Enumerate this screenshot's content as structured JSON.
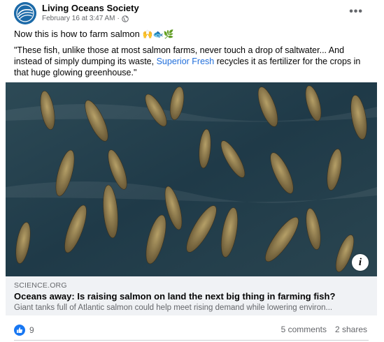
{
  "post": {
    "page_name": "Living Oceans Society",
    "timestamp": "February 16 at 3:47 AM",
    "separator": "·",
    "line1": "Now this is how to farm salmon",
    "emoji": "🙌🐟🌿",
    "quote_before": "\"These fish, unlike those at most salmon farms, never touch a drop of saltwater... And instead of simply dumping its waste, ",
    "quote_link": "Superior Fresh",
    "quote_after": " recycles it as fertilizer for the crops in that huge glowing greenhouse.\""
  },
  "link_preview": {
    "domain": "SCIENCE.ORG",
    "headline": "Oceans away: Is raising salmon on land the next big thing in farming fish?",
    "description": "Giant tanks full of Atlantic salmon could help meet rising demand while lowering environ..."
  },
  "footer": {
    "reaction_count": "9",
    "comments": "5 comments",
    "shares": "2 shares"
  },
  "colors": {
    "link": "#216fdb",
    "like_blue": "#1877f2",
    "secondary_text": "#65676b",
    "preview_bg": "#f0f2f5"
  },
  "icons": [
    "globe-icon",
    "more-options-icon",
    "info-icon",
    "like-icon"
  ]
}
